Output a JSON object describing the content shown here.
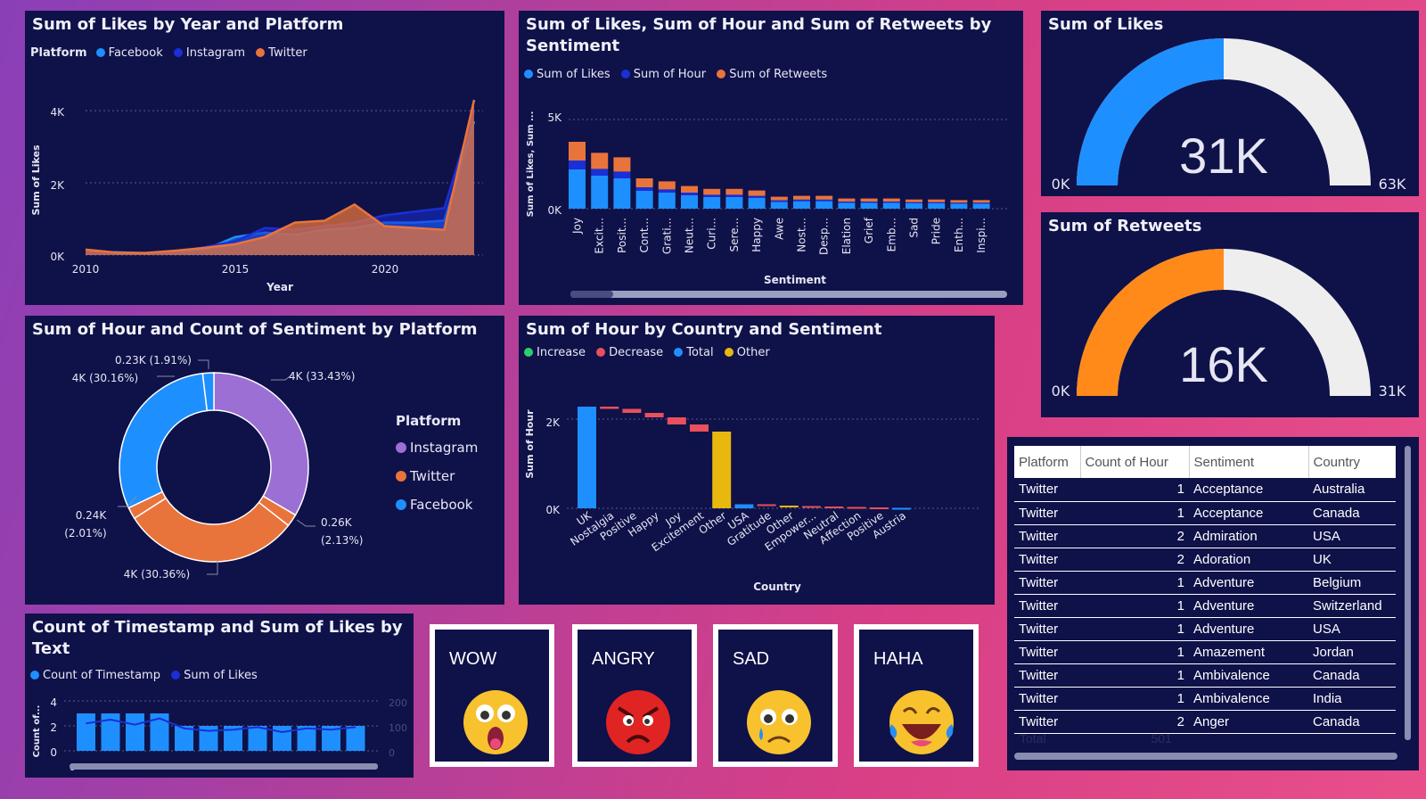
{
  "colors": {
    "facebook": "#1e8fff",
    "instagram": "#1a2fd6",
    "twitter": "#e8743b",
    "gauge_empty": "#eeeeee",
    "gauge_likes": "#1e8fff",
    "gauge_retweets": "#ff8a1a",
    "increase": "#2ecc71",
    "decrease": "#e8505b",
    "total": "#1e8fff",
    "other": "#e8b80f",
    "instagram_donut": "#9b6fd4"
  },
  "p1": {
    "title": "Sum of Likes by Year and Platform",
    "legend_title": "Platform",
    "legend": [
      "Facebook",
      "Instagram",
      "Twitter"
    ],
    "ylabel": "Sum of Likes",
    "xlabel": "Year",
    "yticks": [
      "4K",
      "2K",
      "0K"
    ],
    "xticks": [
      "2010",
      "2015",
      "2020"
    ]
  },
  "p2": {
    "title_line1": "Sum of Likes, Sum of Hour and Sum of Retweets by",
    "title_line2": "Sentiment",
    "legend": [
      "Sum of Likes",
      "Sum of Hour",
      "Sum of Retweets"
    ],
    "ylabel": "Sum of Likes, Sum ...",
    "xlabel": "Sentiment",
    "yticks": [
      "5K",
      "0K"
    ]
  },
  "gauge_likes": {
    "title": "Sum of Likes",
    "value_label": "31K",
    "min": "0K",
    "max": "63K",
    "fraction": 0.5
  },
  "gauge_retweets": {
    "title": "Sum of Retweets",
    "value_label": "16K",
    "min": "0K",
    "max": "31K",
    "fraction": 0.5
  },
  "p3": {
    "title": "Sum of Hour and Count of Sentiment by Platform",
    "legend_title": "Platform",
    "legend": [
      "Instagram",
      "Twitter",
      "Facebook"
    ],
    "labels": {
      "a": "4K (33.43%)",
      "b1": "0.26K",
      "b2": "(2.13%)",
      "c": "4K (30.36%)",
      "d1": "0.24K",
      "d2": "(2.01%)",
      "e": "4K (30.16%)",
      "f": "0.23K (1.91%)"
    }
  },
  "p4": {
    "title": "Sum of Hour by Country and Sentiment",
    "legend": [
      "Increase",
      "Decrease",
      "Total",
      "Other"
    ],
    "ylabel": "Sum of Hour",
    "xlabel": "Country",
    "yticks": [
      "2K",
      "0K"
    ]
  },
  "p5": {
    "title_line1": "Count of Timestamp and Sum of Likes by",
    "title_line2": "Text",
    "legend": [
      "Count of Timestamp",
      "Sum of Likes"
    ],
    "ylabel": "Count of...",
    "yticks_left": [
      "4",
      "2",
      "0"
    ],
    "yticks_right": [
      "200",
      "100",
      "0"
    ],
    "xstart": "0"
  },
  "emojis": {
    "wow": "WOW",
    "angry": "ANGRY",
    "sad": "SAD",
    "haha": "HAHA"
  },
  "table": {
    "headers": [
      "Platform",
      "Count of Hour",
      "Sentiment",
      "Country"
    ],
    "rows": [
      [
        "Twitter",
        "1",
        "Acceptance",
        "Australia"
      ],
      [
        "Twitter",
        "1",
        "Acceptance",
        "Canada"
      ],
      [
        "Twitter",
        "2",
        "Admiration",
        "USA"
      ],
      [
        "Twitter",
        "2",
        "Adoration",
        "UK"
      ],
      [
        "Twitter",
        "1",
        "Adventure",
        "Belgium"
      ],
      [
        "Twitter",
        "1",
        "Adventure",
        "Switzerland"
      ],
      [
        "Twitter",
        "1",
        "Adventure",
        "USA"
      ],
      [
        "Twitter",
        "1",
        "Amazement",
        "Jordan"
      ],
      [
        "Twitter",
        "1",
        "Ambivalence",
        "Canada"
      ],
      [
        "Twitter",
        "1",
        "Ambivalence",
        "India"
      ],
      [
        "Twitter",
        "2",
        "Anger",
        "Canada"
      ]
    ],
    "total_label": "Total",
    "total_value": "501"
  },
  "chart_data": [
    {
      "type": "area",
      "title": "Sum of Likes by Year and Platform",
      "xlabel": "Year",
      "ylabel": "Sum of Likes",
      "x": [
        2010,
        2011,
        2012,
        2013,
        2014,
        2015,
        2016,
        2017,
        2018,
        2019,
        2020,
        2021,
        2022,
        2023
      ],
      "ylim": [
        0,
        4200
      ],
      "series": [
        {
          "name": "Facebook",
          "values": [
            60,
            80,
            50,
            70,
            150,
            500,
            620,
            560,
            700,
            750,
            900,
            900,
            950,
            3700
          ]
        },
        {
          "name": "Instagram",
          "values": [
            50,
            60,
            40,
            90,
            220,
            380,
            750,
            700,
            800,
            900,
            1100,
            1200,
            1300,
            4000
          ]
        },
        {
          "name": "Twitter",
          "values": [
            150,
            70,
            60,
            120,
            200,
            300,
            500,
            900,
            950,
            1400,
            800,
            750,
            700,
            4300
          ]
        }
      ]
    },
    {
      "type": "bar",
      "title": "Sum of Likes, Sum of Hour and Sum of Retweets by Sentiment",
      "xlabel": "Sentiment",
      "categories": [
        "Joy",
        "Excit...",
        "Posit...",
        "Cont...",
        "Grati...",
        "Neut...",
        "Curi...",
        "Sere...",
        "Happy",
        "Awe",
        "Nost...",
        "Desp...",
        "Elation",
        "Grief",
        "Emb...",
        "Sad",
        "Pride",
        "Enth...",
        "Inspi..."
      ],
      "ylim": [
        0,
        5200
      ],
      "series": [
        {
          "name": "Sum of Likes",
          "values": [
            2200,
            1850,
            1700,
            1000,
            900,
            750,
            650,
            650,
            600,
            380,
            420,
            420,
            330,
            330,
            330,
            300,
            300,
            280,
            280
          ]
        },
        {
          "name": "Sum of Hour",
          "values": [
            500,
            380,
            380,
            200,
            180,
            150,
            130,
            130,
            120,
            90,
            90,
            90,
            70,
            70,
            70,
            65,
            65,
            60,
            60
          ]
        },
        {
          "name": "Sum of Retweets",
          "values": [
            1050,
            900,
            800,
            500,
            450,
            370,
            330,
            330,
            300,
            200,
            210,
            210,
            170,
            170,
            170,
            150,
            150,
            140,
            140
          ]
        }
      ]
    },
    {
      "type": "pie",
      "title": "Sum of Hour and Count of Sentiment by Platform",
      "slices": [
        {
          "name": "Instagram",
          "value": 33.43,
          "label": "4K (33.43%)"
        },
        {
          "name": "Twitter",
          "value": 2.13,
          "label": "0.26K (2.13%)"
        },
        {
          "name": "Twitter",
          "value": 30.36,
          "label": "4K (30.36%)"
        },
        {
          "name": "Twitter",
          "value": 2.01,
          "label": "0.24K (2.01%)"
        },
        {
          "name": "Facebook",
          "value": 30.16,
          "label": "4K (30.16%)"
        },
        {
          "name": "Facebook",
          "value": 1.91,
          "label": "0.23K (1.91%)"
        }
      ]
    },
    {
      "type": "bar",
      "title": "Sum of Hour by Country and Sentiment",
      "xlabel": "Country",
      "ylabel": "Sum of Hour",
      "ylim": [
        0,
        2500
      ],
      "categories": [
        "UK",
        "Nostalgia",
        "Positive",
        "Happy",
        "Joy",
        "Excitement",
        "Other",
        "USA",
        "Gratitude",
        "Other",
        "Empower...",
        "Neutral",
        "Affection",
        "Positive",
        "Austria"
      ],
      "kind": [
        "total",
        "decrease",
        "decrease",
        "decrease",
        "decrease",
        "decrease",
        "other",
        "total",
        "decrease",
        "other",
        "decrease",
        "decrease",
        "decrease",
        "decrease",
        "total"
      ],
      "start": [
        0,
        2280,
        2230,
        2140,
        2040,
        1880,
        0,
        0,
        90,
        60,
        50,
        40,
        30,
        20,
        0
      ],
      "end": [
        2280,
        2230,
        2140,
        2040,
        1880,
        1720,
        1720,
        90,
        60,
        50,
        40,
        30,
        20,
        10,
        10
      ]
    },
    {
      "type": "bar",
      "title": "Count of Timestamp and Sum of Likes by Text",
      "ylabel": "Count of...",
      "ylim": [
        0,
        4
      ],
      "series": [
        {
          "name": "Count of Timestamp",
          "values": [
            3,
            3,
            3,
            3,
            2,
            2,
            2,
            2,
            2,
            2,
            2,
            2
          ]
        },
        {
          "name": "Sum of Likes",
          "values": [
            110,
            125,
            105,
            130,
            90,
            80,
            85,
            95,
            75,
            90,
            85,
            95
          ]
        }
      ]
    }
  ]
}
